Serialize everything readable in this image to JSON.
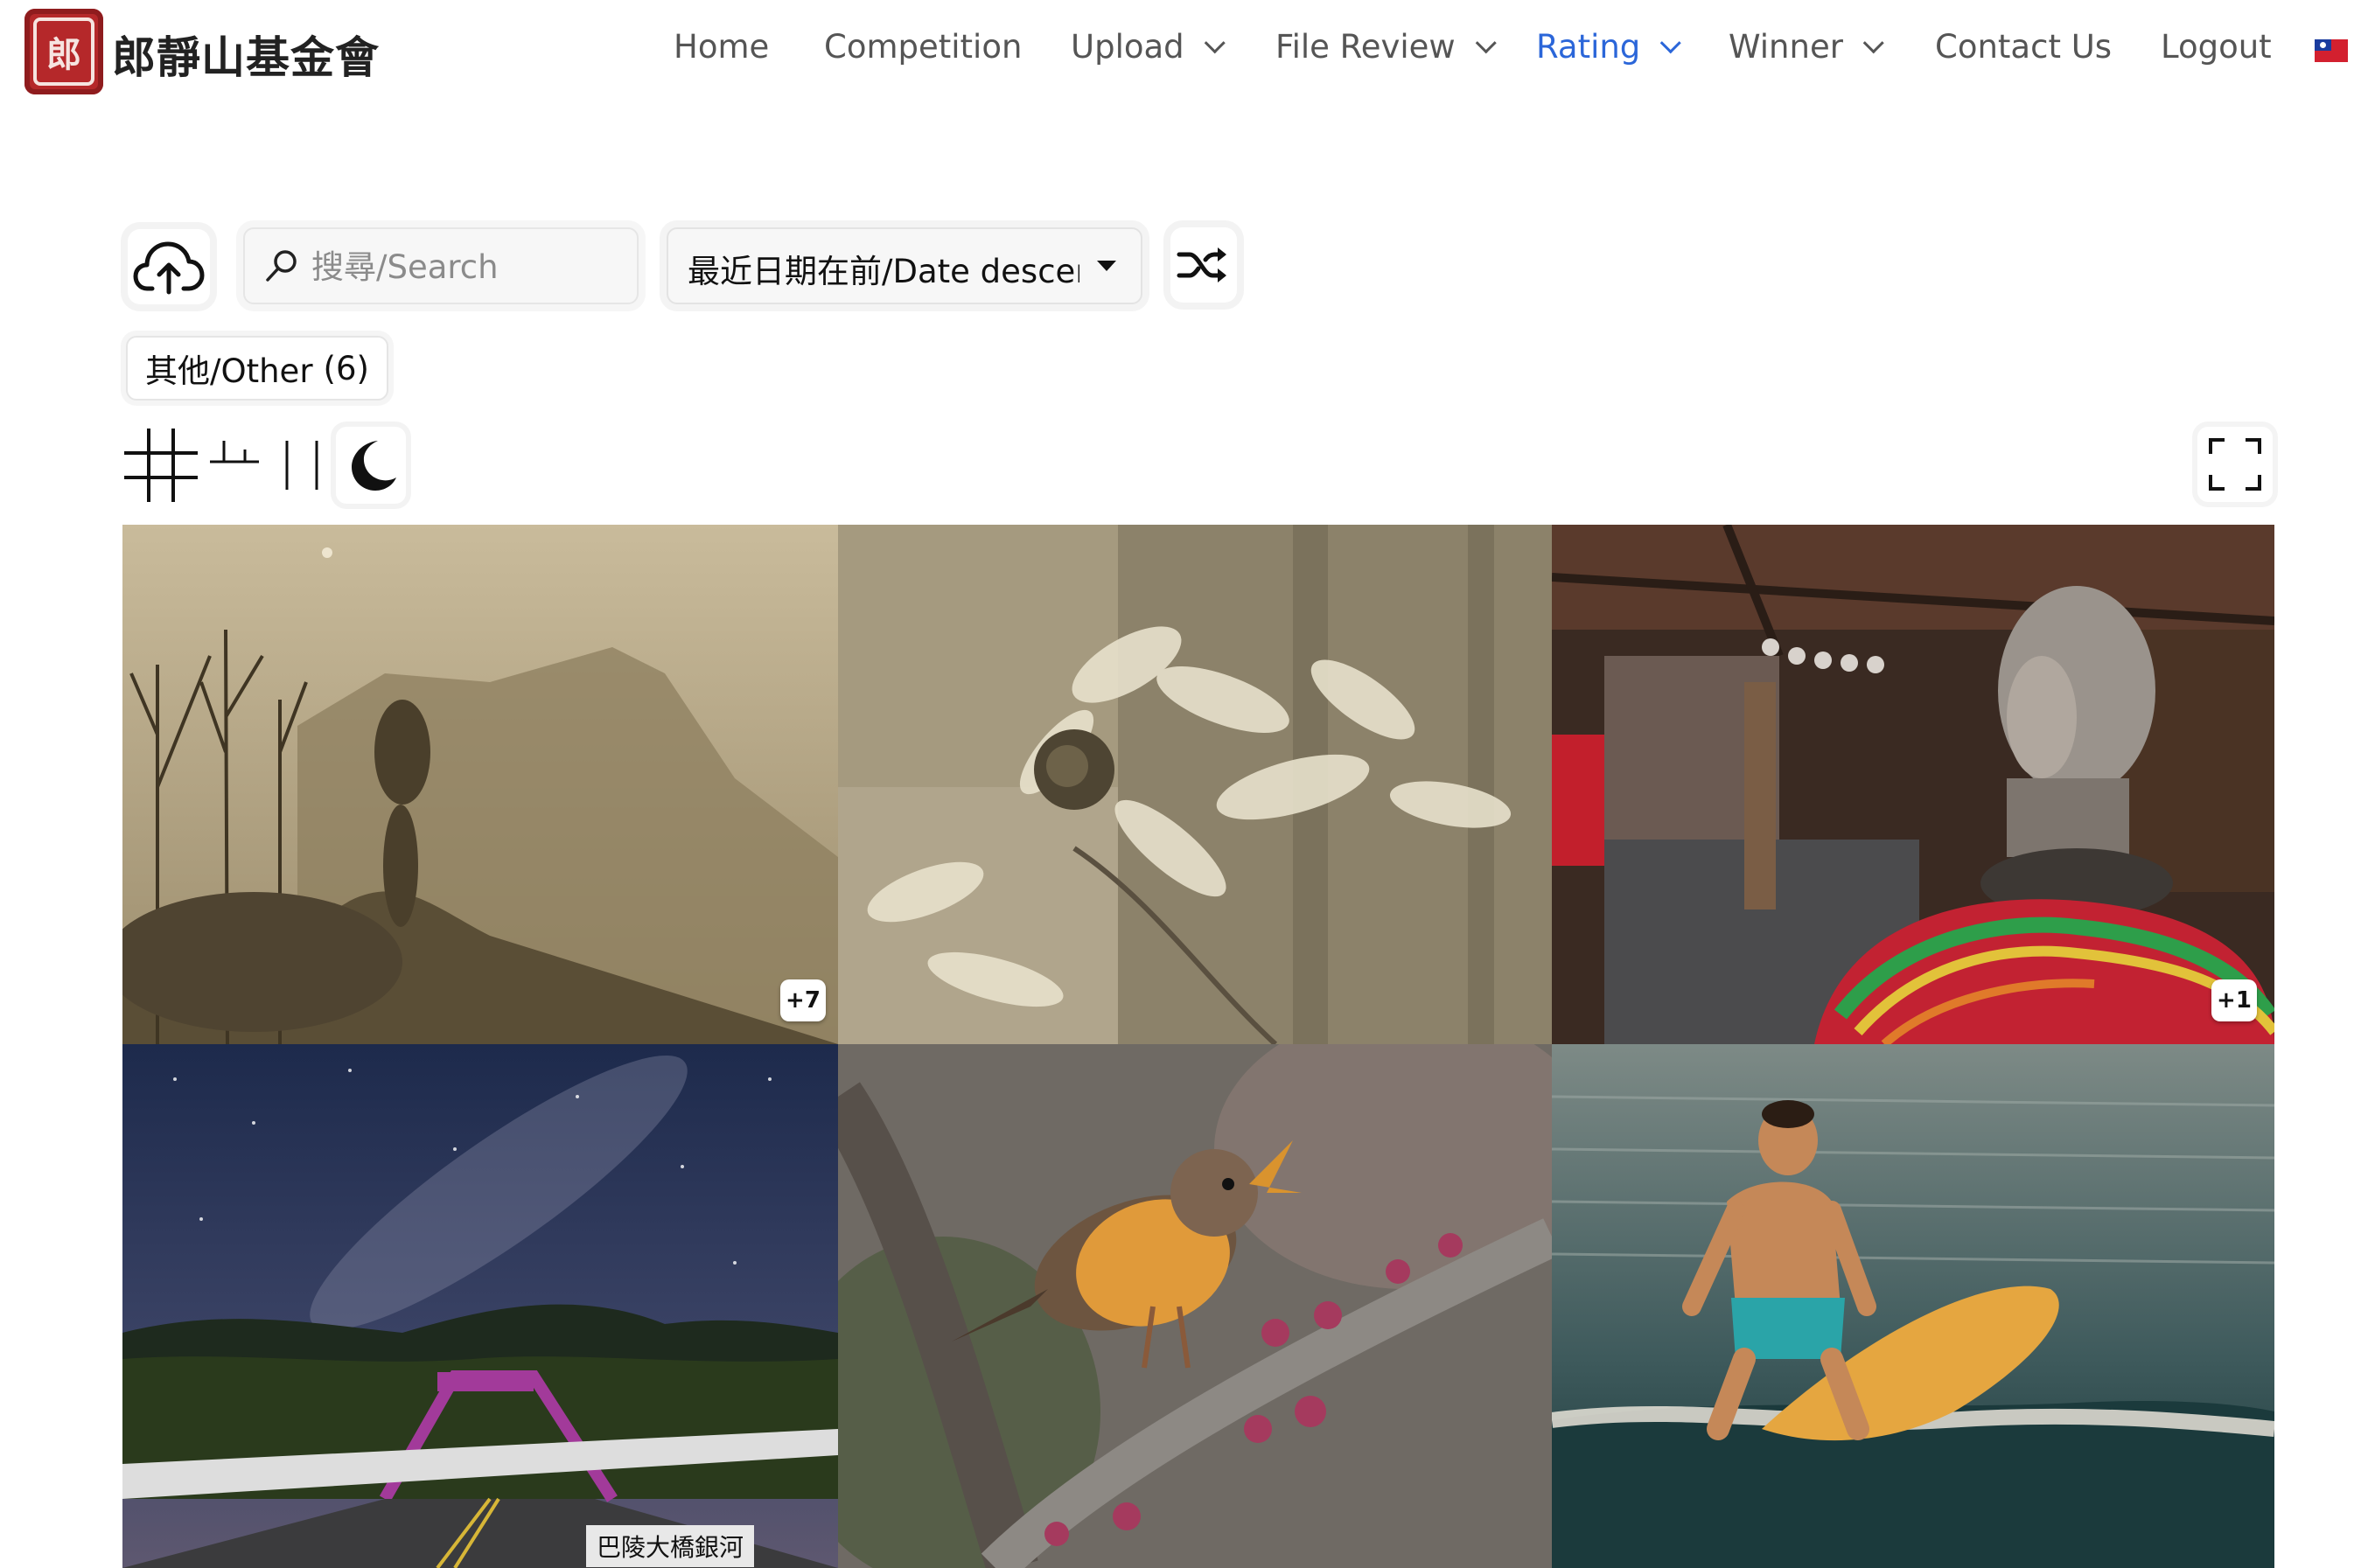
{
  "header": {
    "logo_glyph": "郎",
    "site_name": "郎靜山基金會",
    "nav": [
      {
        "label": "Home",
        "dropdown": false,
        "active": false
      },
      {
        "label": "Competition",
        "dropdown": false,
        "active": false
      },
      {
        "label": "Upload",
        "dropdown": true,
        "active": false
      },
      {
        "label": "File Review",
        "dropdown": true,
        "active": false
      },
      {
        "label": "Rating",
        "dropdown": true,
        "active": true
      },
      {
        "label": "Winner",
        "dropdown": true,
        "active": false
      },
      {
        "label": "Contact Us",
        "dropdown": false,
        "active": false
      },
      {
        "label": "Logout",
        "dropdown": false,
        "active": false
      }
    ],
    "language_flag": "taiwan-flag-icon",
    "accent_color": "#2b66d9"
  },
  "toolbar": {
    "upload_icon": "cloud-upload-icon",
    "search_placeholder": "搜尋/Search",
    "sort_selected": "最近日期在前/Date descending",
    "shuffle_icon": "shuffle-icon"
  },
  "categories": [
    {
      "label": "其他/Other",
      "count": "(6)"
    }
  ],
  "view_tools": {
    "grid_icon": "grid-view-icon",
    "masonry_icon": "masonry-view-icon",
    "columns_icon": "columns-view-icon",
    "dark_mode_icon": "moon-icon",
    "fullscreen_icon": "fullscreen-icon"
  },
  "photos": [
    {
      "subject": "misty-mountain",
      "badge": "+7",
      "caption": ""
    },
    {
      "subject": "flower-branch-sepia",
      "badge": "",
      "caption": ""
    },
    {
      "subject": "sculpture-head",
      "badge": "+1",
      "caption": ""
    },
    {
      "subject": "bridge-milky-way",
      "badge": "",
      "caption": "巴陵大橋銀河"
    },
    {
      "subject": "singing-bird",
      "badge": "",
      "caption": ""
    },
    {
      "subject": "surfer",
      "badge": "",
      "caption": ""
    }
  ]
}
